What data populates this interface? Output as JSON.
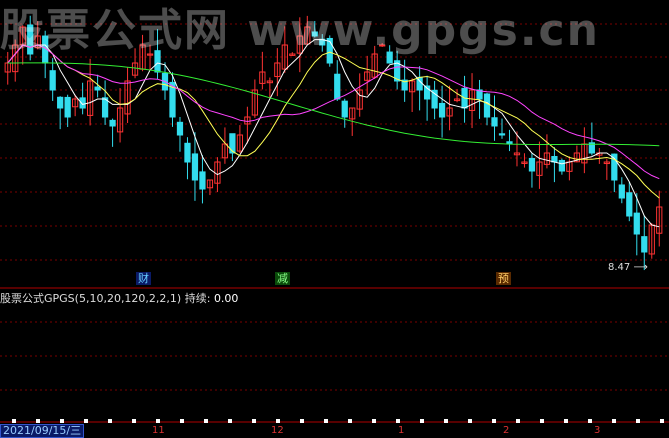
{
  "watermark": "股票公式网 www.gpgs.cn",
  "indicator": {
    "label": "股票公式GPGS(5,10,20,120,2,2,1)",
    "hold_label": "持续:",
    "hold_value": "0.00"
  },
  "tags": [
    {
      "text": "财",
      "style": "blue"
    },
    {
      "text": "减",
      "style": "green"
    },
    {
      "text": "预",
      "style": "orange"
    }
  ],
  "low_label": "8.47",
  "date_label": "2021/09/15/三",
  "months": [
    "11",
    "12",
    "1",
    "2",
    "3"
  ],
  "colors": {
    "up": "#ff3333",
    "down": "#33ddee",
    "ma5": "#ffffff",
    "ma10": "#ffff55",
    "ma20": "#ff44ff",
    "ma120": "#33ee33",
    "grid": "#7a0000"
  },
  "chart_data": {
    "type": "candlestick",
    "x_axis": {
      "type": "date",
      "start_label": "2021/09/15",
      "month_ticks": [
        "11",
        "12",
        "1",
        "2",
        "3"
      ]
    },
    "price_series": [
      10.6,
      10.8,
      11.0,
      10.7,
      10.9,
      10.6,
      10.3,
      10.1,
      10.0,
      10.2,
      10.1,
      10.4,
      10.3,
      10.0,
      9.9,
      10.1,
      10.4,
      10.6,
      10.8,
      10.7,
      10.5,
      10.3,
      10.0,
      9.8,
      9.5,
      9.3,
      9.2,
      9.3,
      9.5,
      9.7,
      9.6,
      9.8,
      10.0,
      10.3,
      10.5,
      10.4,
      10.6,
      10.8,
      10.7,
      10.9,
      11.0,
      10.9,
      10.8,
      10.6,
      10.2,
      10.0,
      10.1,
      10.3,
      10.5,
      10.7,
      10.8,
      10.6,
      10.4,
      10.3,
      10.4,
      10.3,
      10.2,
      10.1,
      10.0,
      10.1,
      10.2,
      10.1,
      10.3,
      10.2,
      10.0,
      9.9,
      9.8,
      9.7,
      9.6,
      9.5,
      9.4,
      9.5,
      9.6,
      9.5,
      9.4,
      9.5,
      9.6,
      9.7,
      9.6,
      9.6,
      9.5,
      9.3,
      9.1,
      8.9,
      8.7,
      8.5,
      8.8,
      9.0
    ],
    "ma_lines": [
      "MA5",
      "MA10",
      "MA20",
      "MA120"
    ],
    "low_marker": 8.47
  }
}
